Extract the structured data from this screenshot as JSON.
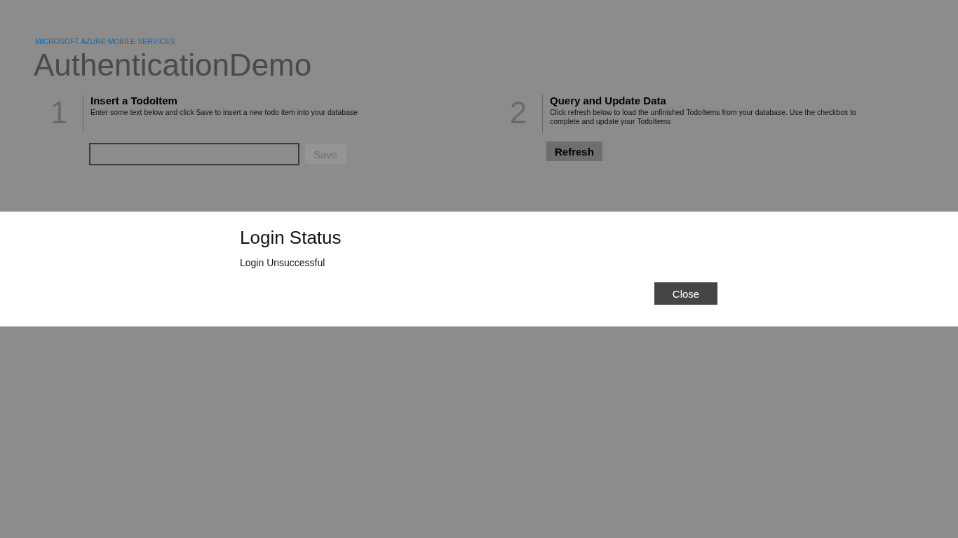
{
  "header": {
    "subtitle": "MICROSOFT AZURE MOBILE SERVICES",
    "title": "AuthenticationDemo"
  },
  "steps": [
    {
      "number": "1",
      "title": "Insert a TodoItem",
      "description": "Enter some text below and click Save to insert a new todo item into your database",
      "kind": "insert",
      "button": {
        "label": "Save",
        "disabled": true
      }
    },
    {
      "number": "2",
      "title": "Query and Update Data",
      "description": "Click refresh below to load the unfinished TodoItems from your database. Use the checkbox to complete and update your TodoItems",
      "kind": "query",
      "button": {
        "label": "Refresh",
        "disabled": false
      }
    }
  ],
  "dialog": {
    "title": "Login Status",
    "message": "Login Unsuccessful",
    "buttons": [
      "Close"
    ]
  }
}
